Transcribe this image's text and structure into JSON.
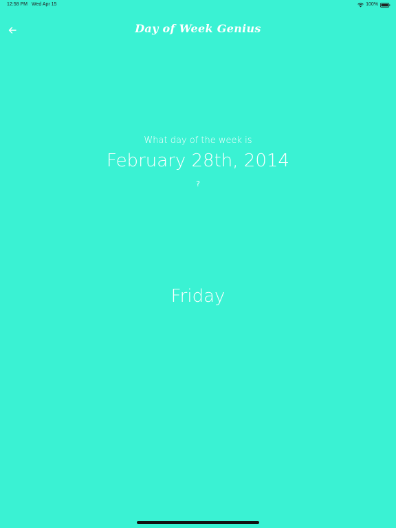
{
  "status_bar": {
    "time": "12:58 PM",
    "date": "Wed Apr 15",
    "battery": "100%",
    "icons": [
      "wifi-icon",
      "battery-icon"
    ]
  },
  "nav": {
    "title": "Day of Week Genius",
    "back_icon": "arrow-left-icon"
  },
  "question": {
    "prompt": "What day of the week is",
    "date": "February 28th, 2014",
    "mark": "?"
  },
  "answer": {
    "text": "Friday"
  },
  "colors": {
    "background": "#3af2d3",
    "text": "#ffffff",
    "status_text": "#222222"
  }
}
